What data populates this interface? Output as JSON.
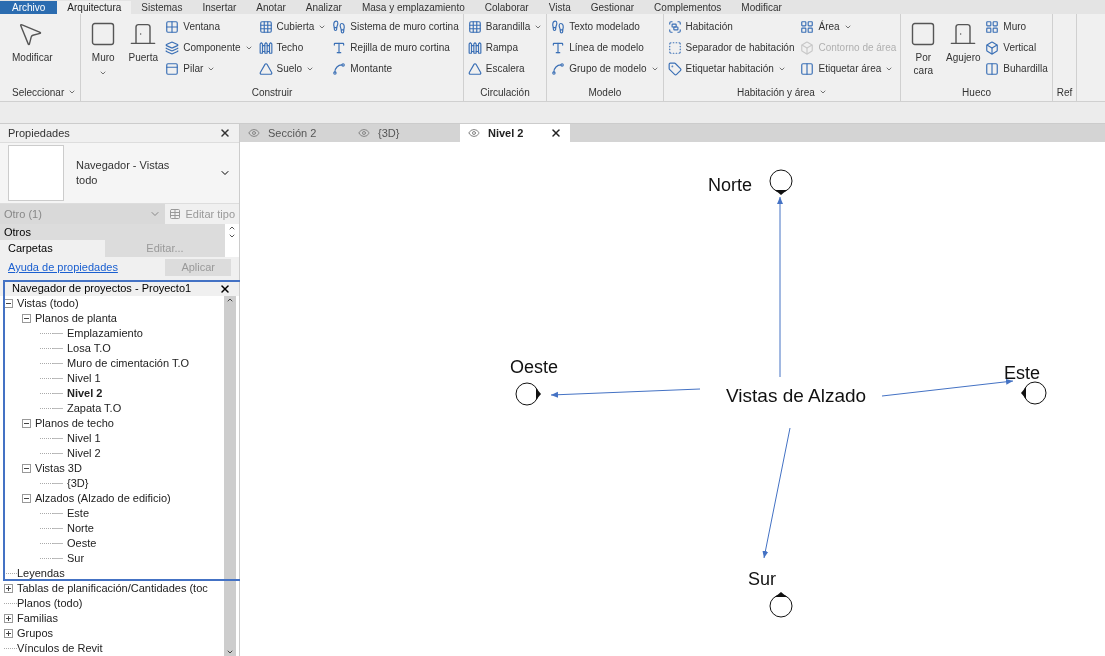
{
  "menu_tabs": [
    {
      "label": "Archivo",
      "kind": "file",
      "selected": false
    },
    {
      "label": "Arquitectura",
      "kind": "tab",
      "selected": true
    },
    {
      "label": "Sistemas",
      "kind": "tab",
      "selected": false
    },
    {
      "label": "Insertar",
      "kind": "tab",
      "selected": false
    },
    {
      "label": "Anotar",
      "kind": "tab",
      "selected": false
    },
    {
      "label": "Analizar",
      "kind": "tab",
      "selected": false
    },
    {
      "label": "Masa y emplazamiento",
      "kind": "tab",
      "selected": false
    },
    {
      "label": "Colaborar",
      "kind": "tab",
      "selected": false
    },
    {
      "label": "Vista",
      "kind": "tab",
      "selected": false
    },
    {
      "label": "Gestionar",
      "kind": "tab",
      "selected": false
    },
    {
      "label": "Complementos",
      "kind": "tab",
      "selected": false
    },
    {
      "label": "Modificar",
      "kind": "tab",
      "selected": false
    }
  ],
  "ribbon_panels": [
    {
      "title": "Seleccionar",
      "dropdown": true,
      "tools": [
        {
          "label": "Modificar",
          "kind": "large",
          "dropdown": false,
          "disabled": false
        }
      ]
    },
    {
      "title": "Construir",
      "dropdown": false,
      "tools": [
        {
          "label": "Muro",
          "kind": "large",
          "dropdown": true,
          "disabled": false
        },
        {
          "label": "Puerta",
          "kind": "large",
          "dropdown": false,
          "disabled": false
        },
        {
          "label": "Ventana",
          "kind": "small",
          "dropdown": false,
          "disabled": false
        },
        {
          "label": "Componente",
          "kind": "small",
          "dropdown": true,
          "disabled": false
        },
        {
          "label": "Pilar",
          "kind": "small",
          "dropdown": true,
          "disabled": false
        },
        {
          "label": "Cubierta",
          "kind": "small",
          "dropdown": true,
          "disabled": false
        },
        {
          "label": "Techo",
          "kind": "small",
          "dropdown": false,
          "disabled": false
        },
        {
          "label": "Suelo",
          "kind": "small",
          "dropdown": true,
          "disabled": false
        },
        {
          "label": "Sistema de muro cortina",
          "kind": "small",
          "dropdown": false,
          "disabled": false
        },
        {
          "label": "Rejilla de muro cortina",
          "kind": "small",
          "dropdown": false,
          "disabled": false
        },
        {
          "label": "Montante",
          "kind": "small",
          "dropdown": false,
          "disabled": false
        }
      ]
    },
    {
      "title": "Circulación",
      "dropdown": false,
      "tools": [
        {
          "label": "Barandilla",
          "kind": "small",
          "dropdown": true,
          "disabled": false
        },
        {
          "label": "Rampa",
          "kind": "small",
          "dropdown": false,
          "disabled": false
        },
        {
          "label": "Escalera",
          "kind": "small",
          "dropdown": false,
          "disabled": false
        }
      ]
    },
    {
      "title": "Modelo",
      "dropdown": false,
      "tools": [
        {
          "label": "Texto modelado",
          "kind": "small",
          "dropdown": false,
          "disabled": false
        },
        {
          "label": "Línea de modelo",
          "kind": "small",
          "dropdown": false,
          "disabled": false
        },
        {
          "label": "Grupo de modelo",
          "kind": "small",
          "dropdown": true,
          "disabled": false
        }
      ]
    },
    {
      "title": "Habitación y área",
      "dropdown": true,
      "tools": [
        {
          "label": "Habitación",
          "kind": "small",
          "dropdown": false,
          "disabled": false
        },
        {
          "label": "Separador de habitación",
          "kind": "small",
          "dropdown": false,
          "disabled": false
        },
        {
          "label": "Etiquetar habitación",
          "kind": "small",
          "dropdown": true,
          "disabled": false
        },
        {
          "label": "Área",
          "kind": "small",
          "dropdown": true,
          "disabled": false
        },
        {
          "label": "Contorno de área",
          "kind": "small",
          "dropdown": false,
          "disabled": true
        },
        {
          "label": "Etiquetar área",
          "kind": "small",
          "dropdown": true,
          "disabled": false
        }
      ]
    },
    {
      "title": "Hueco",
      "dropdown": false,
      "tools": [
        {
          "label": "Por cara",
          "kind": "large",
          "dropdown": false,
          "disabled": false
        },
        {
          "label": "Agujero",
          "kind": "large",
          "dropdown": false,
          "disabled": false
        },
        {
          "label": "Muro",
          "kind": "small",
          "dropdown": false,
          "disabled": false
        },
        {
          "label": "Vertical",
          "kind": "small",
          "dropdown": false,
          "disabled": false
        },
        {
          "label": "Buhardilla",
          "kind": "small",
          "dropdown": false,
          "disabled": false
        }
      ]
    },
    {
      "title": "Ref",
      "dropdown": false
    }
  ],
  "properties": {
    "title": "Propiedades",
    "type_name": "Navegador - Vistas todo",
    "filter": "Otro (1)",
    "edit_type": "Editar tipo",
    "section": "Otros",
    "rows": [
      {
        "label": "Carpetas",
        "value": "Editar..."
      }
    ],
    "help_link": "Ayuda de propiedades",
    "apply": "Aplicar"
  },
  "project_browser": {
    "title": "Navegador de proyectos - Proyecto1",
    "tree": [
      {
        "label": "Vistas (todo)",
        "expanded": true,
        "selected": false,
        "children": [
          {
            "label": "Planos de planta",
            "expanded": true,
            "selected": false,
            "children": [
              {
                "label": "Emplazamiento",
                "selected": false
              },
              {
                "label": "Losa T.O",
                "selected": false
              },
              {
                "label": "Muro de cimentación T.O",
                "selected": false
              },
              {
                "label": "Nivel 1",
                "selected": false
              },
              {
                "label": "Nivel 2",
                "selected": true
              },
              {
                "label": "Zapata T.O",
                "selected": false
              }
            ]
          },
          {
            "label": "Planos de techo",
            "expanded": true,
            "selected": false,
            "children": [
              {
                "label": "Nivel 1",
                "selected": false
              },
              {
                "label": "Nivel 2",
                "selected": false
              }
            ]
          },
          {
            "label": "Vistas 3D",
            "expanded": true,
            "selected": false,
            "children": [
              {
                "label": "{3D}",
                "selected": false
              }
            ]
          },
          {
            "label": "Alzados (Alzado de edificio)",
            "expanded": true,
            "selected": false,
            "children": [
              {
                "label": "Este",
                "selected": false
              },
              {
                "label": "Norte",
                "selected": false
              },
              {
                "label": "Oeste",
                "selected": false
              },
              {
                "label": "Sur",
                "selected": false
              }
            ]
          }
        ]
      },
      {
        "label": "Leyendas",
        "selected": false
      },
      {
        "label": "Tablas de planificación/Cantidades (toc",
        "expanded": false,
        "selected": false
      },
      {
        "label": "Planos (todo)",
        "selected": false
      },
      {
        "label": "Familias",
        "expanded": false,
        "selected": false
      },
      {
        "label": "Grupos",
        "expanded": false,
        "selected": false
      },
      {
        "label": "Vínculos de Revit",
        "selected": false
      }
    ]
  },
  "view_tabs": [
    {
      "label": "Sección 2",
      "selected": false
    },
    {
      "label": "{3D}",
      "selected": false
    },
    {
      "label": "Nivel 2",
      "selected": true
    }
  ],
  "canvas": {
    "center_label": "Vistas de Alzado",
    "markers": [
      {
        "label": "Norte",
        "kind": "north"
      },
      {
        "label": "Oeste",
        "kind": "west"
      },
      {
        "label": "Este",
        "kind": "east"
      },
      {
        "label": "Sur",
        "kind": "south"
      }
    ]
  }
}
